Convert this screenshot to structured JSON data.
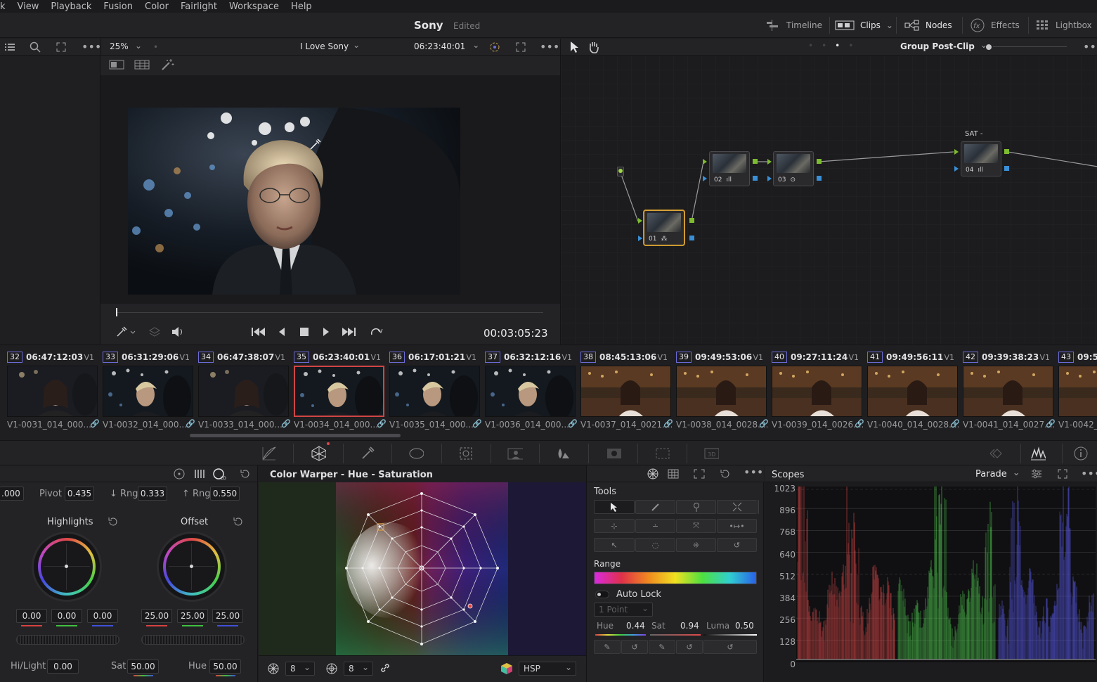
{
  "menu": [
    "k",
    "View",
    "Playback",
    "Fusion",
    "Color",
    "Fairlight",
    "Workspace",
    "Help"
  ],
  "header": {
    "project": "Sony",
    "status": "Edited",
    "buttons": [
      {
        "label": "Timeline",
        "icon": "timeline-icon",
        "active": false
      },
      {
        "label": "Clips",
        "icon": "clips-icon",
        "active": true
      },
      {
        "label": "Nodes",
        "icon": "nodes-icon",
        "active": true
      },
      {
        "label": "Effects",
        "icon": "effects-icon",
        "active": false
      },
      {
        "label": "Lightbox",
        "icon": "lightbox-icon",
        "active": false
      }
    ]
  },
  "viewer": {
    "zoom": "25%",
    "timeline_name": "I Love Sony",
    "timecode": "06:23:40:01",
    "playhead_tc": "00:03:05:23"
  },
  "nodes": {
    "mode": "Group Post-Clip",
    "labels": [
      "01",
      "02",
      "03",
      "04"
    ],
    "node04_title": "SAT -"
  },
  "clips": [
    {
      "num": "32",
      "tc": "06:47:12:03",
      "track": "V1",
      "name": "V1-0031_014_000...",
      "scene": "warm-dark"
    },
    {
      "num": "33",
      "tc": "06:31:29:06",
      "track": "V1",
      "name": "V1-0032_014_000...",
      "scene": "street"
    },
    {
      "num": "34",
      "tc": "06:47:38:07",
      "track": "V1",
      "name": "V1-0033_014_000...",
      "scene": "warm-dark"
    },
    {
      "num": "35",
      "tc": "06:23:40:01",
      "track": "V1",
      "name": "V1-0034_014_000...",
      "scene": "street",
      "selected": true
    },
    {
      "num": "36",
      "tc": "06:17:01:21",
      "track": "V1",
      "name": "V1-0035_014_000...",
      "scene": "street"
    },
    {
      "num": "37",
      "tc": "06:32:12:16",
      "track": "V1",
      "name": "V1-0036_014_000...",
      "scene": "street"
    },
    {
      "num": "38",
      "tc": "08:45:13:06",
      "track": "V1",
      "name": "V1-0037_014_0021....",
      "scene": "bar"
    },
    {
      "num": "39",
      "tc": "09:49:53:06",
      "track": "V1",
      "name": "V1-0038_014_0028....",
      "scene": "bar"
    },
    {
      "num": "40",
      "tc": "09:27:11:24",
      "track": "V1",
      "name": "V1-0039_014_0026....",
      "scene": "bar"
    },
    {
      "num": "41",
      "tc": "09:49:56:11",
      "track": "V1",
      "name": "V1-0040_014_0028....",
      "scene": "bar"
    },
    {
      "num": "42",
      "tc": "09:39:38:23",
      "track": "V1",
      "name": "V1-0041_014_0027....",
      "scene": "bar"
    },
    {
      "num": "43",
      "tc": "09:5",
      "track": "",
      "name": "V1-0042_",
      "scene": "bar"
    }
  ],
  "wheels": {
    "top": {
      "lift_partial": ".000",
      "pivot_label": "Pivot",
      "pivot": "0.435",
      "low_rng_label": "↓ Rng",
      "low_rng": "0.333",
      "high_rng_label": "↑ Rng",
      "high_rng": "0.550"
    },
    "highlights": {
      "label": "Highlights",
      "values": [
        "0.00",
        "0.00",
        "0.00"
      ]
    },
    "offset": {
      "label": "Offset",
      "values": [
        "25.00",
        "25.00",
        "25.00"
      ]
    },
    "bottom": {
      "hilight_label": "Hi/Light",
      "hilight": "0.00",
      "sat_label": "Sat",
      "sat": "50.00",
      "hue_label": "Hue",
      "hue": "50.00"
    }
  },
  "warper": {
    "title": "Color Warper - Hue - Saturation",
    "grid_a": "8",
    "grid_b": "8",
    "color_space": "HSP"
  },
  "tools": {
    "title": "Tools",
    "range_label": "Range",
    "autolock": "Auto Lock",
    "point_mode": "1 Point",
    "hue_label": "Hue",
    "hue": "0.44",
    "sat_label": "Sat",
    "sat": "0.94",
    "luma_label": "Luma",
    "luma": "0.50"
  },
  "scopes": {
    "title": "Scopes",
    "mode": "Parade",
    "ticks": [
      "1023",
      "896",
      "768",
      "640",
      "512",
      "384",
      "256",
      "128",
      "0"
    ]
  },
  "colors": {
    "accent": "#d8a33a",
    "selected_clip": "#d04545",
    "red": "#e04848",
    "green": "#4fd04f",
    "blue": "#5a5af0"
  }
}
